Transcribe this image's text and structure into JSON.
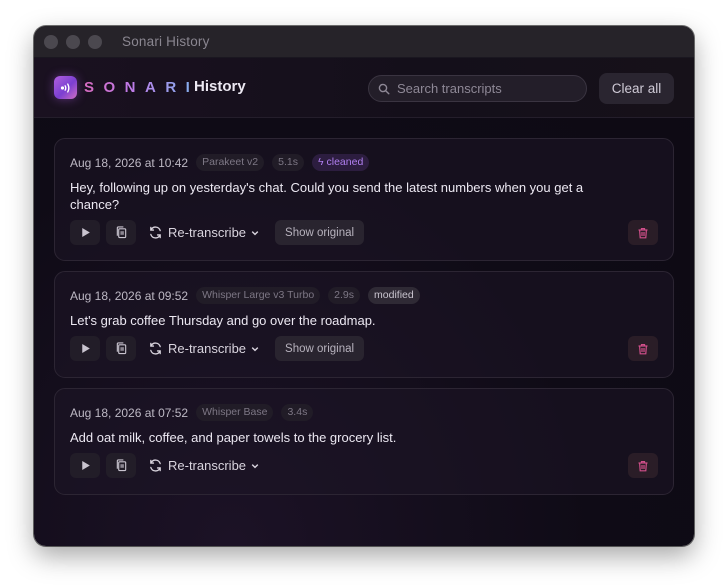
{
  "window": {
    "title": "Sonari History"
  },
  "header": {
    "brand": "SONARI",
    "page_title": "History",
    "search_placeholder": "Search transcripts",
    "clear_label": "Clear all"
  },
  "colors": {
    "accent_purple": "#b07ff0",
    "danger_pink": "#d04f8a",
    "brand_gradient_start": "#d66bc0",
    "brand_gradient_end": "#7fb6f0"
  },
  "actions": {
    "retranscribe_label": "Re-transcribe",
    "show_original_label": "Show original"
  },
  "items": [
    {
      "date": "Aug 18, 2026 at 10:42",
      "model": "Parakeet v2",
      "duration": "5.1s",
      "tag": "cleaned",
      "text": "Hey, following up on yesterday's chat. Could you send the latest numbers when you get a chance?"
    },
    {
      "date": "Aug 18, 2026 at 09:52",
      "model": "Whisper Large v3 Turbo",
      "duration": "2.9s",
      "tag": "modified",
      "text": "Let's grab coffee Thursday and go over the roadmap."
    },
    {
      "date": "Aug 18, 2026 at 07:52",
      "model": "Whisper Base",
      "duration": "3.4s",
      "text": "Add oat milk, coffee, and paper towels to the grocery list."
    }
  ]
}
